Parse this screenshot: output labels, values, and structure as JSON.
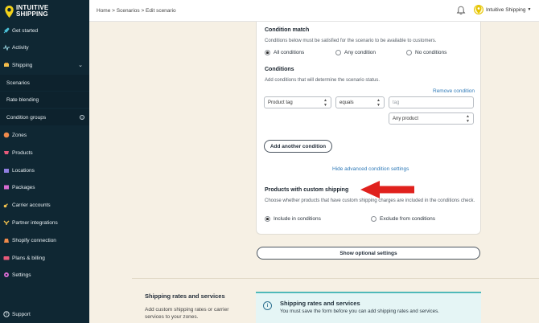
{
  "brand": {
    "line1": "INTUITIVE",
    "line2": "SHIPPING"
  },
  "sidebar": {
    "items": [
      {
        "label": "Get started",
        "icon": "rocket-icon"
      },
      {
        "label": "Activity",
        "icon": "activity-icon"
      },
      {
        "label": "Shipping",
        "icon": "shipping-icon",
        "expanded": true
      },
      {
        "label": "Scenarios"
      },
      {
        "label": "Rate blending"
      },
      {
        "label": "Condition groups"
      },
      {
        "label": "Zones",
        "icon": "globe-icon"
      },
      {
        "label": "Products",
        "icon": "tag-icon"
      },
      {
        "label": "Locations",
        "icon": "building-icon"
      },
      {
        "label": "Packages",
        "icon": "box-icon"
      },
      {
        "label": "Carrier accounts",
        "icon": "key-icon"
      },
      {
        "label": "Partner integrations",
        "icon": "plug-icon"
      },
      {
        "label": "Shopify connection",
        "icon": "shopify-icon"
      },
      {
        "label": "Plans & billing",
        "icon": "card-icon"
      },
      {
        "label": "Settings",
        "icon": "gear-icon"
      },
      {
        "label": "Support",
        "icon": "help-icon"
      }
    ]
  },
  "topbar": {
    "breadcrumb": "Home > Scenarios > Edit scenario",
    "user": "Intuitive Shipping"
  },
  "condition_match": {
    "title": "Condition match",
    "description": "Conditions below must be satisfied for the scenario to be available to customers.",
    "options": [
      "All conditions",
      "Any condition",
      "No conditions"
    ],
    "selected": "All conditions"
  },
  "conditions": {
    "title": "Conditions",
    "description": "Add conditions that will determine the scenario status.",
    "remove_label": "Remove condition",
    "field": "Product tag",
    "operator": "equals",
    "value_placeholder": "tag",
    "scope": "Any product",
    "add_label": "Add another condition",
    "hide_advanced_label": "Hide advanced condition settings"
  },
  "custom_shipping": {
    "title": "Products with custom shipping",
    "description": "Choose whether products that have custom shipping charges are included in the conditions check.",
    "options": [
      "Include in conditions",
      "Exclude from conditions"
    ],
    "selected": "Include in conditions"
  },
  "optional_settings_label": "Show optional settings",
  "rates_section": {
    "title": "Shipping rates and services",
    "description": "Add custom shipping rates or carrier services to your zones.",
    "banner_title": "Shipping rates and services",
    "banner_message": "You must save the form before you can add shipping rates and services."
  },
  "colors": {
    "sidebar": "#0f2733",
    "accent_red": "#e0211d",
    "link": "#2f7ab8",
    "banner_border": "#4fb9b9"
  }
}
